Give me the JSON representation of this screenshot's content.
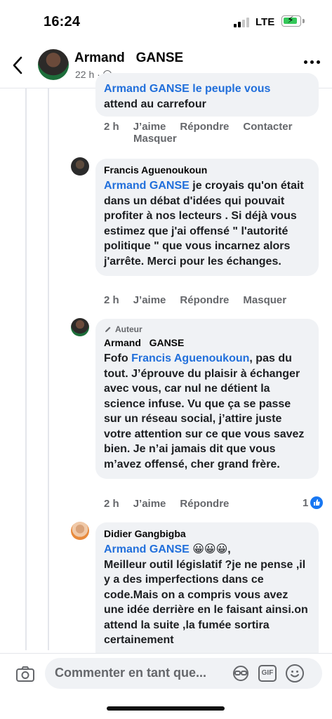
{
  "status_bar": {
    "time": "16:24",
    "network": "LTE"
  },
  "header": {
    "name": "Armand   GANSE",
    "meta_time": "22 h ·"
  },
  "comments": [
    {
      "partial_text_line1": "Armand   GANSE le peuple vous",
      "partial_text_line2": "attend au carrefour",
      "actions": {
        "time": "2 h",
        "like": "J’aime",
        "reply": "Répondre",
        "contact": "Contacter",
        "hide": "Masquer"
      }
    },
    {
      "author": "Francis Aguenoukoun",
      "mention": "Armand   GANSE",
      "text": " je croyais qu'on était dans un débat d'idées qui pouvait profiter à nos lecteurs . Si déjà vous estimez que j'ai offensé \" l'autorité politique \" que vous incarnez alors j'arrête. Merci pour les échanges.",
      "actions": {
        "time": "2 h",
        "like": "J’aime",
        "reply": "Répondre",
        "hide": "Masquer"
      }
    },
    {
      "badge": "Auteur",
      "author": "Armand   GANSE",
      "prefix": "Fofo ",
      "mention": "Francis Aguenoukoun",
      "text": ", pas du tout. J’éprouve du plaisir à échanger avec vous, car nul ne détient la science infuse. Vu que ça se passe sur un réseau social, j’attire juste votre attention sur ce que vous savez bien. Je n’ai jamais dit que vous m’avez offensé, cher grand frère.",
      "actions": {
        "time": "2 h",
        "like": "J’aime",
        "reply": "Répondre"
      },
      "reaction_count": "1"
    },
    {
      "author": "Didier Gangbigba",
      "mention": "Armand GANSE",
      "emojis": " 😀😀😀,",
      "text": "Meilleur outil législatif ?je ne pense ,il y a des imperfections dans ce code.Mais on a compris vous avez une idée derrière en le faisant ainsi.on attend la suite ,la fumée sortira certainement"
    }
  ],
  "composer": {
    "placeholder": "Commenter en tant que..."
  },
  "colors": {
    "mention": "#216fdb",
    "bubble": "#f0f2f5",
    "secondary_text": "#65676b",
    "like_blue": "#1877f2"
  }
}
